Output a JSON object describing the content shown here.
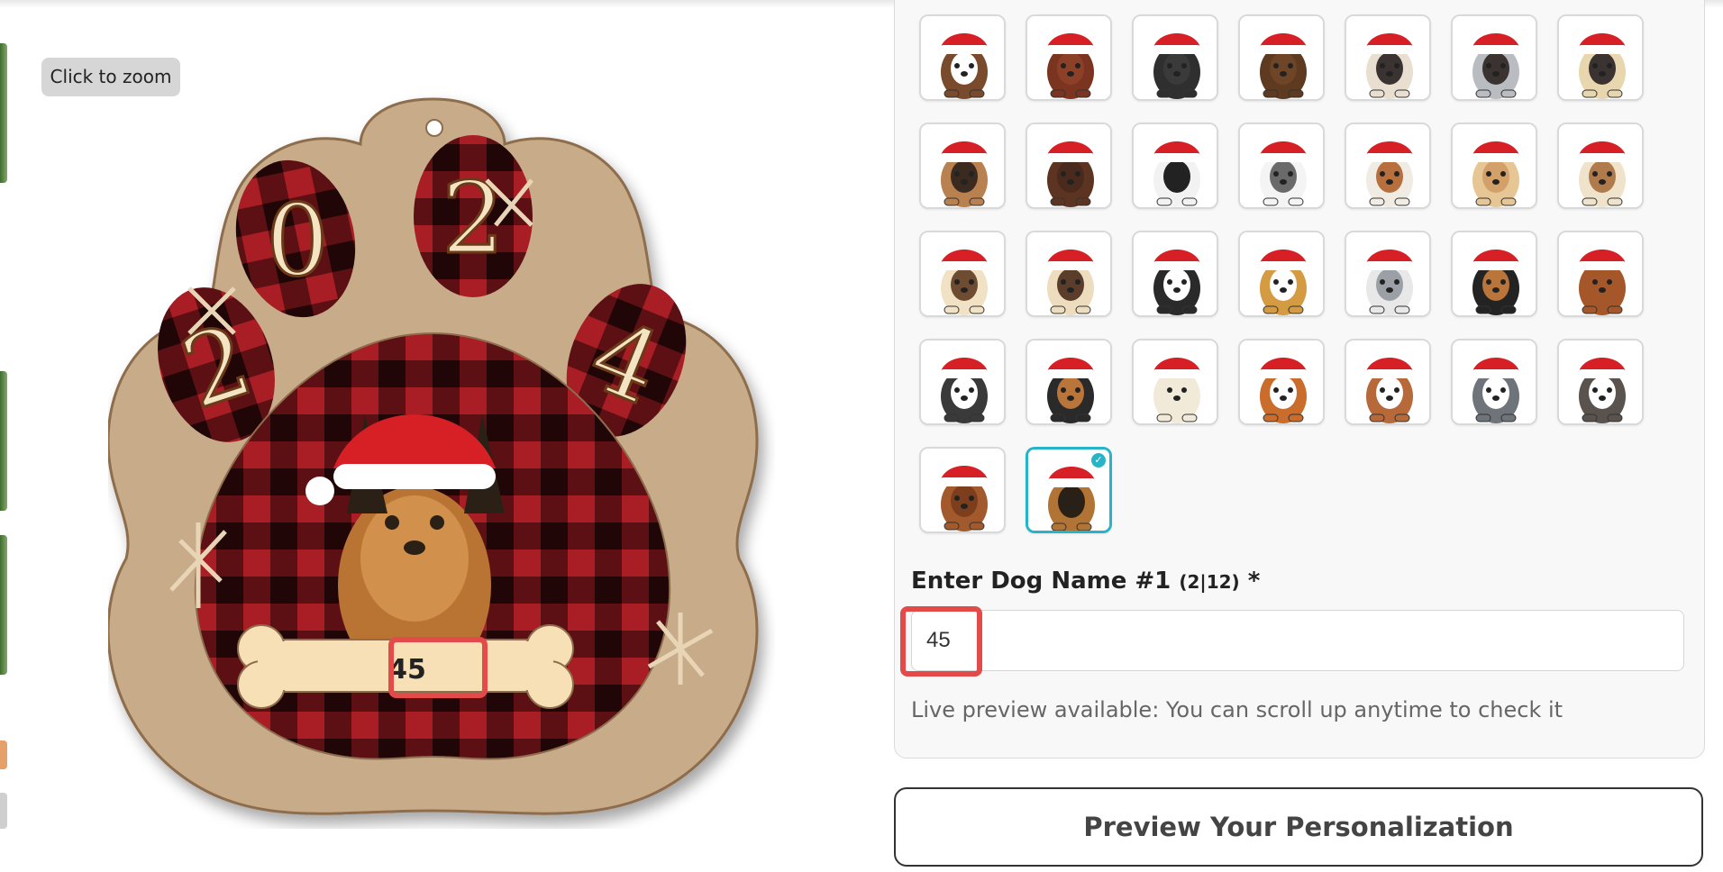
{
  "zoom_badge": "Click to zoom",
  "product_preview": {
    "ornament_year_digits": [
      "2",
      "0",
      "2",
      "4"
    ],
    "bone_name_text": "45"
  },
  "breed_grid": {
    "rows": [
      [
        {
          "fur": "#7a4a2c",
          "face": "#ffffff"
        },
        {
          "fur": "#7a3420",
          "face": "#8d4028"
        },
        {
          "fur": "#2f2f2f",
          "face": "#3a3a3a"
        },
        {
          "fur": "#5d3a20",
          "face": "#6e4527"
        },
        {
          "fur": "#e9dfd0",
          "face": "#3a3331"
        },
        {
          "fur": "#b9bcc1",
          "face": "#3a3331"
        },
        {
          "fur": "#e8d6ae",
          "face": "#3a3331"
        }
      ],
      [
        {
          "fur": "#b98050",
          "face": "#3a2a20"
        },
        {
          "fur": "#5d3422",
          "face": "#4a2a1c"
        },
        {
          "fur": "#f2f2f2",
          "face": "#222222"
        },
        {
          "fur": "#f4f4f4",
          "face": "#6a6a6a"
        },
        {
          "fur": "#f1ece3",
          "face": "#b7703d"
        },
        {
          "fur": "#e6c695",
          "face": "#d4a06a"
        },
        {
          "fur": "#efe3cb",
          "face": "#b07b4c"
        }
      ],
      [
        {
          "fur": "#f1e2c6",
          "face": "#6e4c32"
        },
        {
          "fur": "#eddcbd",
          "face": "#5a3d2a"
        },
        {
          "fur": "#2a2a2a",
          "face": "#ffffff"
        },
        {
          "fur": "#d59b42",
          "face": "#ffffff"
        },
        {
          "fur": "#e8e8e8",
          "face": "#9aa0a6"
        },
        {
          "fur": "#232323",
          "face": "#b9753a"
        },
        {
          "fur": "#a6572a",
          "face": "#a6572a"
        }
      ],
      [
        {
          "fur": "#3a3a3a",
          "face": "#ffffff"
        },
        {
          "fur": "#2a2a2a",
          "face": "#b9753a"
        },
        {
          "fur": "#f2ead9",
          "face": "#f2ead9"
        },
        {
          "fur": "#c96c2c",
          "face": "#ffffff"
        },
        {
          "fur": "#b7693a",
          "face": "#ffffff"
        },
        {
          "fur": "#6f747a",
          "face": "#ffffff"
        },
        {
          "fur": "#5a524c",
          "face": "#ffffff"
        }
      ],
      [
        {
          "fur": "#a25a2c",
          "face": "#7c3e1d"
        },
        {
          "fur": "#b17434",
          "face": "#2b2016",
          "selected": true
        }
      ]
    ]
  },
  "dog_name_field": {
    "label": "Enter Dog Name #1",
    "counter": "(2|12)",
    "required_mark": "*",
    "value": "45"
  },
  "live_preview_note": "Live preview available: You can scroll up anytime to check it",
  "preview_button": "Preview Your Personalization",
  "colors": {
    "selected_border": "#27b4c9",
    "highlight": "#e34a4a",
    "plaid_red": "#a81e24",
    "wood": "#c8ab89"
  }
}
